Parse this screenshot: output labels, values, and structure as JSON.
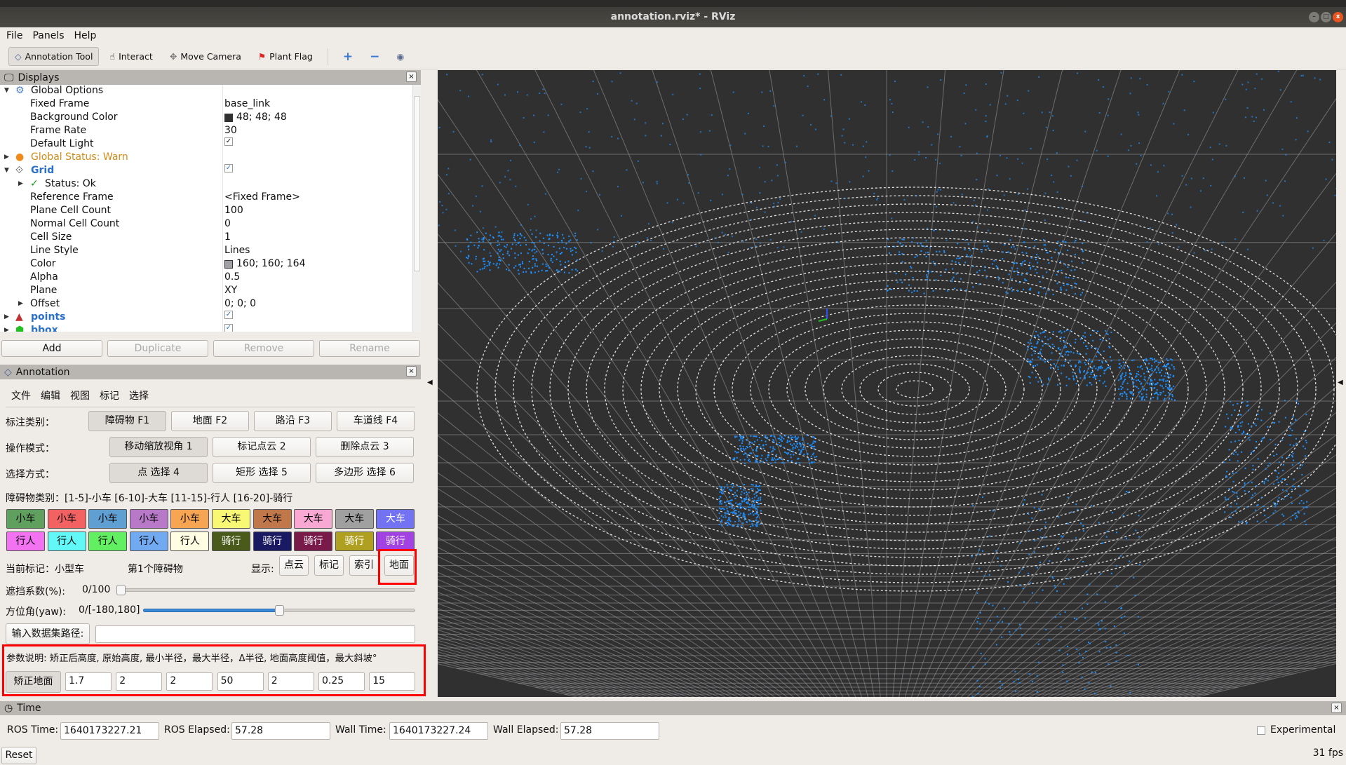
{
  "window": {
    "title": "annotation.rviz* - RViz",
    "minimize": "–",
    "maximize": "□",
    "close": "x"
  },
  "menu": [
    "File",
    "Panels",
    "Help"
  ],
  "toolbar": {
    "tools": [
      {
        "label": "Annotation Tool",
        "icon": "diamond-icon",
        "active": true
      },
      {
        "label": "Interact",
        "icon": "hand-icon"
      },
      {
        "label": "Move Camera",
        "icon": "move-camera-icon"
      },
      {
        "label": "Plant Flag",
        "icon": "flag-icon"
      }
    ],
    "plus": "+",
    "minus": "−",
    "eye": "◉"
  },
  "displays": {
    "title": "Displays",
    "close": "×",
    "rows": [
      {
        "label": "Global Options",
        "indent": 0,
        "arrow": "▼",
        "icon": "gear-icon",
        "value": ""
      },
      {
        "label": "Fixed Frame",
        "indent": 1,
        "value": "base_link"
      },
      {
        "label": "Background Color",
        "indent": 1,
        "value": "48; 48; 48",
        "swatch": "#303030"
      },
      {
        "label": "Frame Rate",
        "indent": 1,
        "value": "30"
      },
      {
        "label": "Default Light",
        "indent": 1,
        "check": "✓"
      },
      {
        "label": "Global Status: Warn",
        "indent": 0,
        "arrow": "▶",
        "icon": "warning-icon",
        "color": "#d08a1a"
      },
      {
        "label": "Grid",
        "indent": 0,
        "arrow": "▼",
        "icon": "grid-icon",
        "color": "#2a6fc9",
        "bold": true,
        "check": "✓"
      },
      {
        "label": "Status: Ok",
        "indent": 1,
        "arrow": "▶",
        "icon": "check-icon"
      },
      {
        "label": "Reference Frame",
        "indent": 1,
        "value": "<Fixed Frame>"
      },
      {
        "label": "Plane Cell Count",
        "indent": 1,
        "value": "100"
      },
      {
        "label": "Normal Cell Count",
        "indent": 1,
        "value": "0"
      },
      {
        "label": "Cell Size",
        "indent": 1,
        "value": "1"
      },
      {
        "label": "Line Style",
        "indent": 1,
        "value": "Lines"
      },
      {
        "label": "Color",
        "indent": 1,
        "value": "160; 160; 164",
        "swatch": "#a0a0a4"
      },
      {
        "label": "Alpha",
        "indent": 1,
        "value": "0.5"
      },
      {
        "label": "Plane",
        "indent": 1,
        "value": "XY"
      },
      {
        "label": "Offset",
        "indent": 1,
        "arrow": "▶",
        "value": "0; 0; 0"
      },
      {
        "label": "points",
        "indent": 0,
        "arrow": "▶",
        "icon": "points-icon",
        "color": "#2a6fc9",
        "bold": true,
        "check": "✓"
      },
      {
        "label": "bbox",
        "indent": 0,
        "arrow": "▶",
        "icon": "bbox-icon",
        "color": "#2a6fc9",
        "bold": true,
        "check": "✓"
      }
    ],
    "buttons": [
      {
        "label": "Add",
        "disabled": false
      },
      {
        "label": "Duplicate",
        "disabled": true
      },
      {
        "label": "Remove",
        "disabled": true
      },
      {
        "label": "Rename",
        "disabled": true
      }
    ]
  },
  "annotation": {
    "title": "Annotation",
    "close": "×",
    "menu": [
      "文件",
      "编辑",
      "视图",
      "标记",
      "选择"
    ],
    "category_label": "标注类别：",
    "categories": [
      "障碍物 F1",
      "地面 F2",
      "路沿 F3",
      "车道线 F4"
    ],
    "mode_label": "操作模式：",
    "modes": [
      "移动缩放视角 1",
      "标记点云 2",
      "删除点云 3"
    ],
    "select_label": "选择方式：",
    "selects": [
      "点 选择 4",
      "矩形 选择 5",
      "多边形 选择 6"
    ],
    "obstacle_legend": "障碍物类别：[1-5]-小车   [6-10]-大车   [11-15]-行人   [16-20]-骑行",
    "classes": [
      {
        "label": "小车",
        "bg": "#5fa05f",
        "fg": "#000"
      },
      {
        "label": "小车",
        "bg": "#f26262",
        "fg": "#000"
      },
      {
        "label": "小车",
        "bg": "#5f9fd2",
        "fg": "#000"
      },
      {
        "label": "小车",
        "bg": "#b87ac8",
        "fg": "#000"
      },
      {
        "label": "小车",
        "bg": "#f7a552",
        "fg": "#000"
      },
      {
        "label": "大车",
        "bg": "#f8f874",
        "fg": "#000"
      },
      {
        "label": "大车",
        "bg": "#c0784a",
        "fg": "#000"
      },
      {
        "label": "大车",
        "bg": "#f8a8d2",
        "fg": "#000"
      },
      {
        "label": "大车",
        "bg": "#a0a0a0",
        "fg": "#000"
      },
      {
        "label": "大车",
        "bg": "#7272f2",
        "fg": "#fff"
      },
      {
        "label": "行人",
        "bg": "#f272f2",
        "fg": "#000"
      },
      {
        "label": "行人",
        "bg": "#62f8f8",
        "fg": "#000"
      },
      {
        "label": "行人",
        "bg": "#62f062",
        "fg": "#000"
      },
      {
        "label": "行人",
        "bg": "#72aaf2",
        "fg": "#000"
      },
      {
        "label": "行人",
        "bg": "#fffde2",
        "fg": "#000"
      },
      {
        "label": "骑行",
        "bg": "#4a5a1a",
        "fg": "#fff"
      },
      {
        "label": "骑行",
        "bg": "#1a1a62",
        "fg": "#fff"
      },
      {
        "label": "骑行",
        "bg": "#7a1a4a",
        "fg": "#fff"
      },
      {
        "label": "骑行",
        "bg": "#b0a022",
        "fg": "#fff"
      },
      {
        "label": "骑行",
        "bg": "#a242e2",
        "fg": "#fff"
      }
    ],
    "current_mark": "当前标记：小型车",
    "obstacle_index": "第1个障碍物",
    "show_label": "显示:",
    "show_buttons": [
      "点云",
      "标记",
      "索引",
      "地面"
    ],
    "occlusion_label": "遮挡系数(%):",
    "occlusion_value": "0/100",
    "occlusion_fraction": 0,
    "yaw_label": "方位角(yaw):",
    "yaw_value": "0/[-180,180]",
    "yaw_fraction": 0.5,
    "path_button": "输入数据集路径:",
    "path_value": "",
    "params_desc": "参数说明: 矫正后高度, 原始高度, 最小半径，最大半径，Δ半径, 地面高度阈值，最大斜坡°",
    "correct_button": "矫正地面",
    "params": [
      "1.7",
      "2",
      "2",
      "50",
      "2",
      "0.25",
      "15"
    ],
    "highlight_color": "#ff0000"
  },
  "time": {
    "title": "Time",
    "close": "×",
    "ros_time_label": "ROS Time:",
    "ros_time": "1640173227.21",
    "ros_elapsed_label": "ROS Elapsed:",
    "ros_elapsed": "57.28",
    "wall_time_label": "Wall Time:",
    "wall_time": "1640173227.24",
    "wall_elapsed_label": "Wall Elapsed:",
    "wall_elapsed": "57.28",
    "experimental": "Experimental",
    "reset": "Reset",
    "fps": "31 fps"
  },
  "viewport": {
    "background": "#303030",
    "grid_color": "#a0a0a4",
    "point_color": "#1e90ff"
  }
}
